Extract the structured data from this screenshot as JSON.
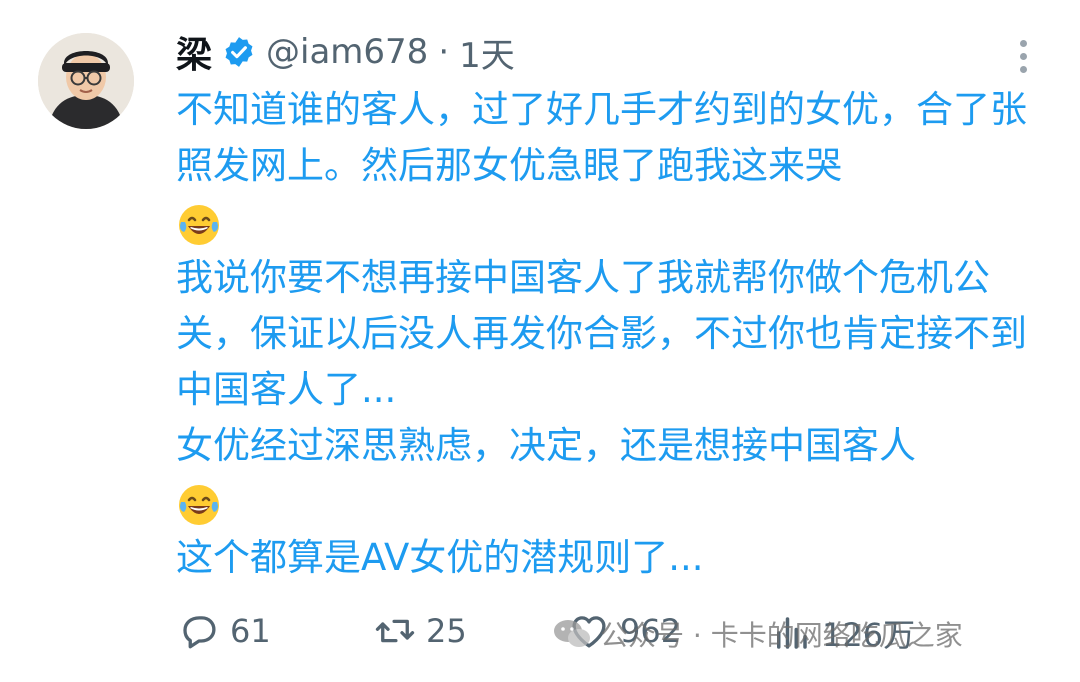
{
  "tweet": {
    "author_name": "梁",
    "handle": "@iam678",
    "separator": "·",
    "time": "1天",
    "paragraphs": [
      "不知道谁的客人，过了好几手才约到的女优，合了张照发网上。然后那女优急眼了跑我这来哭",
      "我说你要不想再接中国客人了我就帮你做个危机公关，保证以后没人再发你合影，不过你也肯定接不到中国客人了...",
      "女优经过深思熟虑，决定，还是想接中国客人",
      "这个都算是AV女优的潜规则了..."
    ]
  },
  "actions": {
    "replies": "61",
    "retweets": "25",
    "likes": "962",
    "views": "126万"
  },
  "watermark": {
    "text": "公众号 · 卡卡的网络吃瓜之家"
  },
  "colors": {
    "text_blue": "#1d9bf0",
    "secondary": "#536471",
    "verified": "#1d9bf0"
  }
}
